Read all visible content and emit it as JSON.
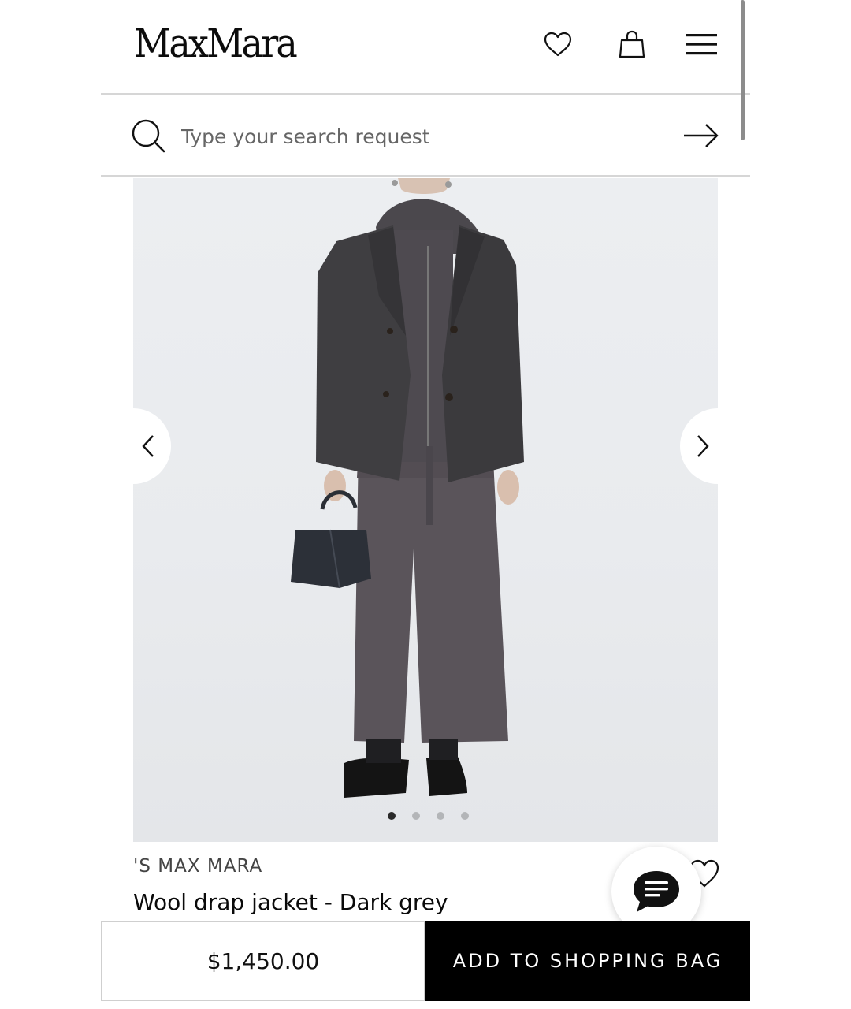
{
  "header": {
    "logo": "MaxMara",
    "icons": [
      "heart-icon",
      "shopping-bag-icon",
      "hamburger-menu-icon"
    ]
  },
  "search": {
    "placeholder": "Type your search request",
    "icon": "search-icon",
    "submit_icon": "arrow-right-icon"
  },
  "gallery": {
    "image_count": 4,
    "active_index": 0,
    "prev_icon": "chevron-left-icon",
    "next_icon": "chevron-right-icon"
  },
  "product": {
    "brand": "'S MAX MARA",
    "name": "Wool drap jacket - Dark grey",
    "price": "$1,450.00",
    "add_to_bag_label": "ADD TO SHOPPING BAG"
  },
  "chat": {
    "icon": "chat-bubble-icon"
  },
  "colors": {
    "primary": "#000000",
    "background": "#ffffff",
    "image_bg": "#eceef1",
    "divider": "#d6d6d6"
  }
}
